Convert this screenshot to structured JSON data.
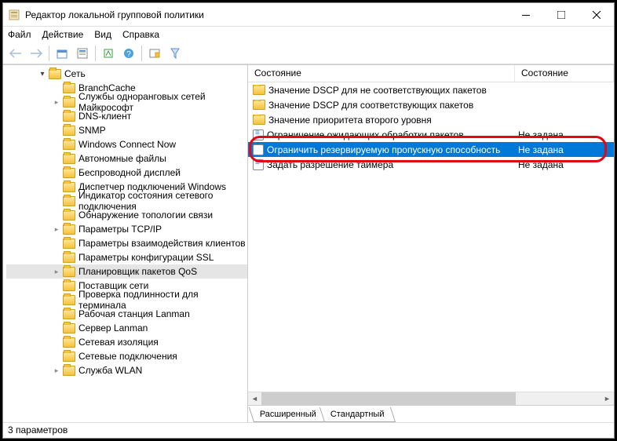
{
  "window": {
    "title": "Редактор локальной групповой политики"
  },
  "menu": {
    "file": "Файл",
    "action": "Действие",
    "view": "Вид",
    "help": "Справка"
  },
  "toolbar_icons": [
    "back",
    "forward",
    "up",
    "sep",
    "list",
    "help",
    "sep",
    "export",
    "properties",
    "filter"
  ],
  "tree": {
    "root": "Сеть",
    "items": [
      {
        "label": "BranchCache",
        "expandable": false
      },
      {
        "label": "Службы одноранговых сетей Майкрософт",
        "expandable": true
      },
      {
        "label": "DNS-клиент",
        "expandable": false
      },
      {
        "label": "SNMP",
        "expandable": false
      },
      {
        "label": "Windows Connect Now",
        "expandable": false
      },
      {
        "label": "Автономные файлы",
        "expandable": false
      },
      {
        "label": "Беспроводной дисплей",
        "expandable": false
      },
      {
        "label": "Диспетчер подключений Windows",
        "expandable": false
      },
      {
        "label": "Индикатор состояния сетевого подключения",
        "expandable": false
      },
      {
        "label": "Обнаружение топологии связи",
        "expandable": false
      },
      {
        "label": "Параметры TCP/IP",
        "expandable": true
      },
      {
        "label": "Параметры взаимодействия клиентов",
        "expandable": false
      },
      {
        "label": "Параметры конфигурации SSL",
        "expandable": false
      },
      {
        "label": "Планировщик пакетов QoS",
        "expandable": true,
        "selected": true
      },
      {
        "label": "Поставщик сети",
        "expandable": false
      },
      {
        "label": "Проверка подлинности для терминала",
        "expandable": false
      },
      {
        "label": "Рабочая станция Lanman",
        "expandable": false
      },
      {
        "label": "Сервер Lanman",
        "expandable": false
      },
      {
        "label": "Сетевая изоляция",
        "expandable": false
      },
      {
        "label": "Сетевые подключения",
        "expandable": false
      },
      {
        "label": "Служба WLAN",
        "expandable": true
      }
    ]
  },
  "list": {
    "columns": {
      "name": "Состояние",
      "state": "Состояние"
    },
    "rows": [
      {
        "icon": "folder",
        "name": "Значение DSCP для не соответствующих пакетов",
        "state": ""
      },
      {
        "icon": "folder",
        "name": "Значение DSCP для соответствующих пакетов",
        "state": ""
      },
      {
        "icon": "folder",
        "name": "Значение приоритета второго уровня",
        "state": ""
      },
      {
        "icon": "setting",
        "name": "Ограничение ожидающих обработки пакетов",
        "state": "Не задана"
      },
      {
        "icon": "setting",
        "name": "Ограничить резервируемую пропускную способность",
        "state": "Не задана",
        "selected": true
      },
      {
        "icon": "setting",
        "name": "Задать разрешение таймера",
        "state": "Не задана"
      }
    ]
  },
  "tabs": {
    "extended": "Расширенный",
    "standard": "Стандартный"
  },
  "statusbar": "3 параметров"
}
